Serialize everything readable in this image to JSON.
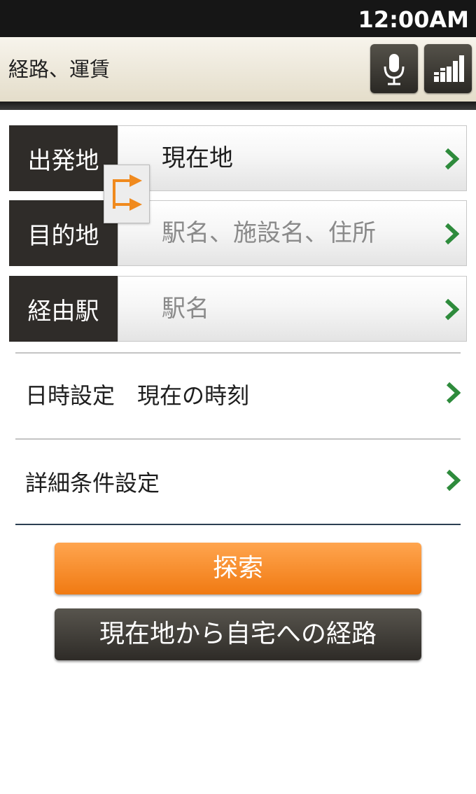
{
  "status_bar": {
    "time": "12:00AM"
  },
  "header": {
    "title": "経路、運賃",
    "mic_icon": "microphone-icon",
    "menu_icon": "bar-steps-icon"
  },
  "fields": [
    {
      "label": "出発地",
      "value": "現在地",
      "placeholder": "",
      "filled": true
    },
    {
      "label": "目的地",
      "value": "",
      "placeholder": "駅名、施設名、住所",
      "filled": false
    },
    {
      "label": "経由駅",
      "value": "",
      "placeholder": "駅名",
      "filled": false
    }
  ],
  "settings": {
    "datetime": "日時設定　現在の時刻",
    "detail": "詳細条件設定"
  },
  "buttons": {
    "search": "探索",
    "home_route": "現在地から自宅への経路"
  },
  "colors": {
    "accent": "#f07a12",
    "chevron": "#2e8b3c",
    "label_bg": "#2f2c29"
  }
}
